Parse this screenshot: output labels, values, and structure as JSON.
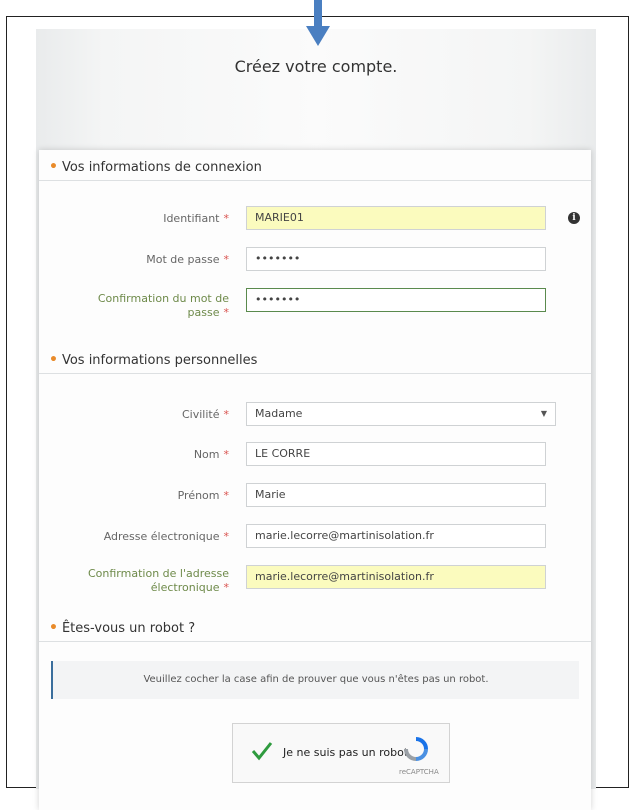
{
  "page_title": "Créez votre compte.",
  "sections": {
    "connexion": "Vos informations de connexion",
    "personnelles": "Vos informations personnelles",
    "robot": "Êtes-vous un robot ?"
  },
  "required_mark": "*",
  "fields": {
    "identifiant": {
      "label": "Identifiant",
      "value": "MARIE01"
    },
    "password": {
      "label": "Mot de passe",
      "value": "•••••••"
    },
    "password_confirm": {
      "label_line1": "Confirmation du mot de",
      "label_line2": "passe",
      "value": "•••••••"
    },
    "civilite": {
      "label": "Civilité",
      "value": "Madame"
    },
    "nom": {
      "label": "Nom",
      "value": "LE CORRE"
    },
    "prenom": {
      "label": "Prénom",
      "value": "Marie"
    },
    "email": {
      "label": "Adresse électronique",
      "value": "marie.lecorre@martinisolation.fr"
    },
    "email_confirm": {
      "label_line1": "Confirmation de l'adresse",
      "label_line2": "électronique",
      "value": "marie.lecorre@martinisolation.fr"
    }
  },
  "info_icon": "i",
  "robot_message": "Veuillez cocher la case afin de prouver que vous n'êtes pas un robot.",
  "captcha": {
    "label": "Je ne suis pas un robot",
    "brand": "reCAPTCHA"
  },
  "colors": {
    "accent": "#e98b2a",
    "required": "#d9534f",
    "highlight": "#fbfbbe",
    "arrow": "#4a7fc1"
  }
}
